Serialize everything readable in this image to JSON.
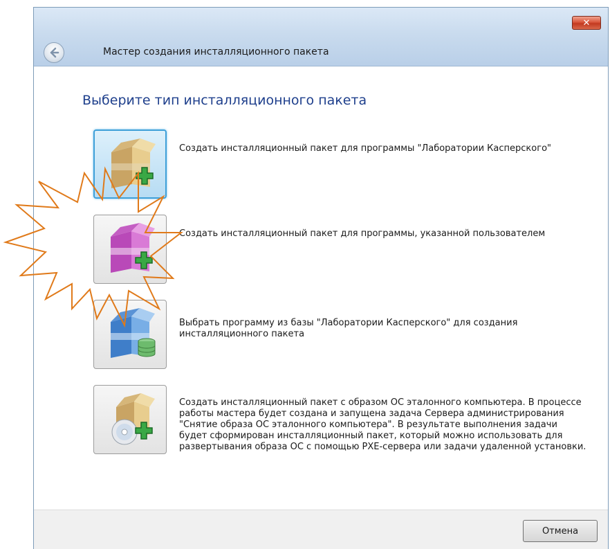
{
  "window": {
    "title": "Мастер создания инсталляционного пакета",
    "close_label": "✕"
  },
  "heading": "Выберите тип инсталляционного пакета",
  "options": [
    {
      "label": "Создать инсталляционный пакет для программы \"Лаборатории Касперского\"",
      "icon": "package-add-icon",
      "selected": true
    },
    {
      "label": "Создать инсталляционный пакет для программы, указанной пользователем",
      "icon": "custom-package-add-icon",
      "selected": false
    },
    {
      "label": "Выбрать программу из базы \"Лаборатории Касперского\" для создания инсталляционного пакета",
      "icon": "package-database-icon",
      "selected": false
    },
    {
      "label": "Создать инсталляционный пакет с образом ОС эталонного компьютера. В процессе работы мастера будет создана и запущена задача Сервера администрирования \"Снятие образа ОС эталонного компьютера\". В результате выполнения задачи будет сформирован инсталляционный пакет, который можно использовать для развертывания образа ОС с помощью PXE-сервера или задачи удаленной установки.",
      "icon": "package-disc-icon",
      "selected": false
    }
  ],
  "footer": {
    "cancel_label": "Отмена"
  },
  "colors": {
    "heading": "#1e3f8c",
    "selection": "#3fa0d8",
    "burst": "#e07a1a"
  }
}
